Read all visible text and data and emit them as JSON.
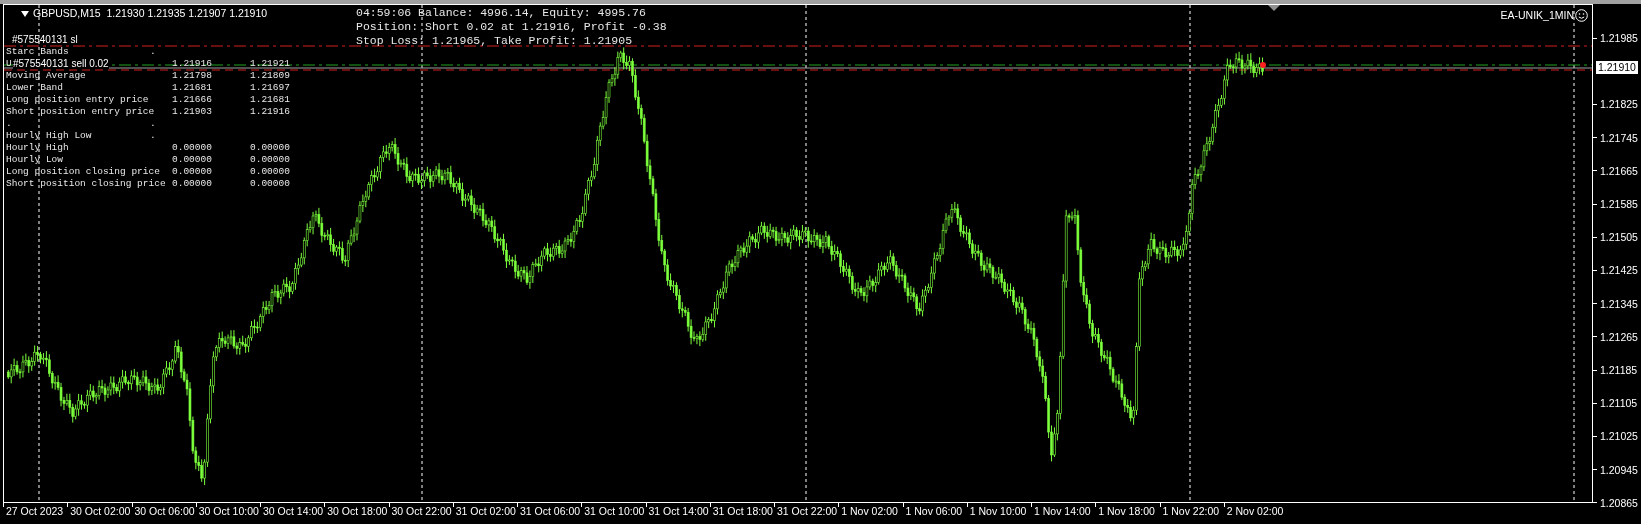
{
  "chart": {
    "header": "GBPUSD,M15  1.21930 1.21935 1.21907 1.21910",
    "ea_name": "EA-UNIK_1MIN",
    "order_label": "#575540131 sl",
    "trade_label": "#575540131 sell 0.02",
    "status_lines": [
      "04:59:06 Balance: 4996.14, Equity: 4995.76",
      "Position: Short 0.02 at 1.21916, Profit -0.38",
      "Stop Loss: 1.21965, Take Profit: 1.21905"
    ],
    "indicator_rows": [
      {
        "label": "Starc Bands",
        "mark": "."
      },
      {
        "label": "U",
        "value_1": "1.21916",
        "value_2": "1.21921"
      },
      {
        "label": "Moving Average",
        "value_1": "1.21798",
        "value_2": "1.21809"
      },
      {
        "label": "Lower Band",
        "value_1": "1.21681",
        "value_2": "1.21697"
      },
      {
        "label": "Long position entry price",
        "value_1": "1.21666",
        "value_2": "1.21681"
      },
      {
        "label": "Short position entry price",
        "value_1": "1.21903",
        "value_2": "1.21916"
      },
      {
        "label": ".",
        "mark": "."
      },
      {
        "label": "Hourly High Low",
        "mark": "."
      },
      {
        "label": "Hourly High",
        "value_1": "0.00000",
        "value_2": "0.00000"
      },
      {
        "label": "Hourly Low",
        "value_1": "0.00000",
        "value_2": "0.00000"
      },
      {
        "label": "Long position closing price",
        "value_1": "0.00000",
        "value_2": "0.00000"
      },
      {
        "label": "Short position closing price",
        "value_1": "0.00000",
        "value_2": "0.00000"
      }
    ],
    "price_axis": [
      "1.21985",
      "1.21825",
      "1.21745",
      "1.21665",
      "1.21585",
      "1.21505",
      "1.21425",
      "1.21345",
      "1.21265",
      "1.21185",
      "1.21105",
      "1.21025",
      "1.20945",
      "1.20865"
    ],
    "current_price": "1.21910",
    "time_axis": [
      "27 Oct 2023",
      "30 Oct 02:00",
      "30 Oct 06:00",
      "30 Oct 10:00",
      "30 Oct 14:00",
      "30 Oct 18:00",
      "30 Oct 22:00",
      "31 Oct 02:00",
      "31 Oct 06:00",
      "31 Oct 10:00",
      "31 Oct 14:00",
      "31 Oct 18:00",
      "31 Oct 22:00",
      "1 Nov 02:00",
      "1 Nov 06:00",
      "1 Nov 10:00",
      "1 Nov 14:00",
      "1 Nov 18:00",
      "1 Nov 22:00",
      "2 Nov 02:00"
    ]
  }
}
